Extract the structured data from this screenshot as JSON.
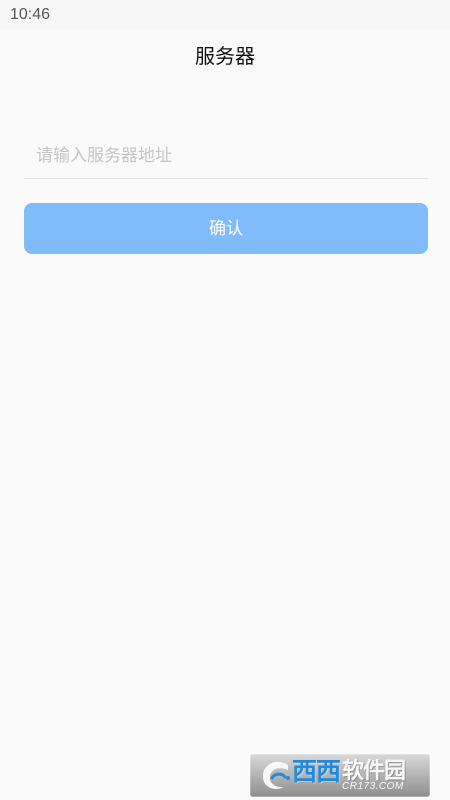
{
  "status_bar": {
    "time": "10:46"
  },
  "header": {
    "title": "服务器"
  },
  "form": {
    "server_input": {
      "value": "",
      "placeholder": "请输入服务器地址"
    },
    "confirm_label": "确认"
  },
  "watermark": {
    "brand_blue": "西西",
    "brand_white": "软件园",
    "domain": "CR173.COM"
  },
  "colors": {
    "background": "#fafafa",
    "button": "#80bcfb",
    "placeholder": "#c5c5c5"
  }
}
